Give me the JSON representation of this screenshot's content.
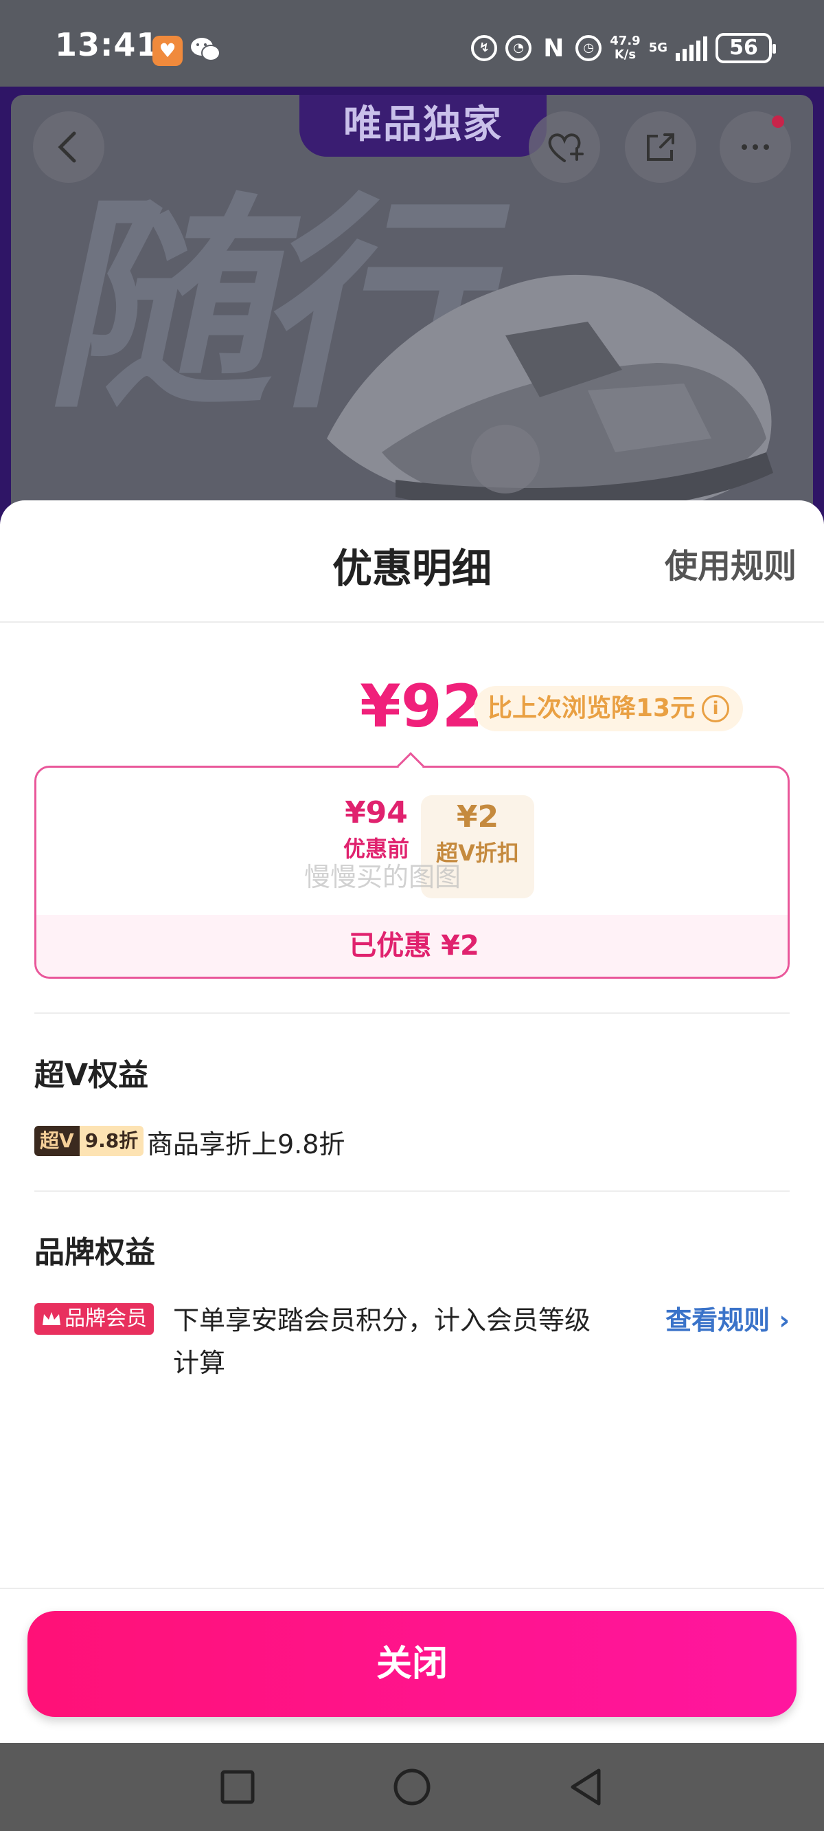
{
  "status_bar": {
    "time": "13:41",
    "net_speed_value": "47.9",
    "net_speed_unit": "K/s",
    "network": "5G",
    "battery": "56"
  },
  "product": {
    "exclusive_label": "唯品独家",
    "bg_text": "随行"
  },
  "sheet": {
    "title": "优惠明细",
    "rules_link": "使用规则",
    "price": "¥92",
    "drop_badge": "比上次浏览降13元",
    "calc": {
      "before_value": "¥94",
      "before_label": "优惠前",
      "minus": "-",
      "vip_value": "¥2",
      "vip_label": "超V折扣",
      "watermark": "慢慢买的图图",
      "saved": "已优惠 ¥2"
    },
    "vip_section": {
      "title": "超V权益",
      "tag_dark": "超V",
      "tag_light": "9.8折",
      "text": "商品享折上9.8折"
    },
    "brand_section": {
      "title": "品牌权益",
      "tag": "品牌会员",
      "text_line1": "下单享安踏会员积分，计入会员等级",
      "text_line2": "计算",
      "view_rules": "查看规则"
    },
    "close_button": "关闭"
  }
}
